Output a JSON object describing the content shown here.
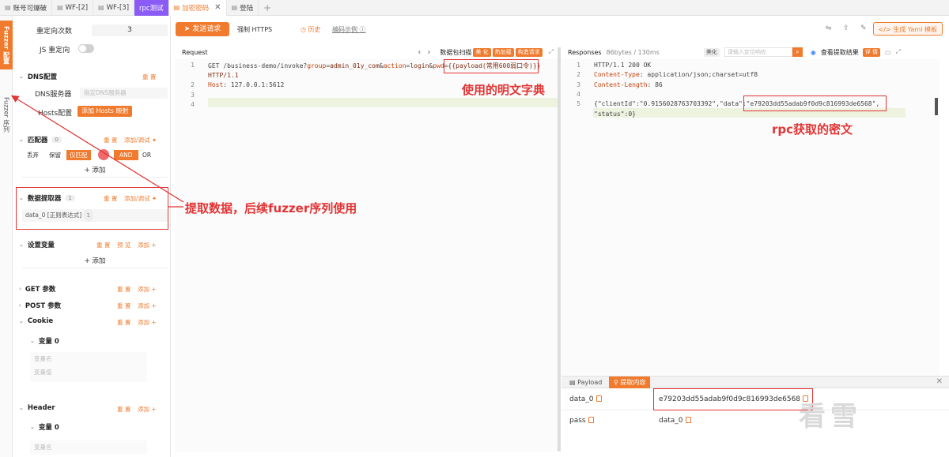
{
  "tabs": [
    {
      "label": "账号可爆破",
      "type": "normal"
    },
    {
      "label": "WF-[2]",
      "type": "normal"
    },
    {
      "label": "WF-[3]",
      "type": "normal"
    },
    {
      "label": "rpc测试",
      "type": "purple"
    },
    {
      "label": "加密密码",
      "type": "active"
    },
    {
      "label": "登陆",
      "type": "normal"
    }
  ],
  "sidetabs": {
    "fuzzer_config": "Fuzzer 配置",
    "fuzzer_sequence": "Fuzzer 序列"
  },
  "left": {
    "redirect_label": "重定向次数",
    "redirect_value": "3",
    "js_redirect_label": "JS 重定向",
    "dns_section": "DNS配置",
    "dns_reset": "重 置",
    "dns_server_label": "DNS服务器",
    "dns_server_placeholder": "指定DNS服务器",
    "hosts_label": "Hosts配置",
    "hosts_button": "添加 Hosts 映射",
    "matcher_section": "匹配器",
    "matcher_count": "0",
    "matcher_reset": "重 置",
    "matcher_add": "添加/调试 ✦",
    "matcher_opts": [
      "丢弃",
      "保留",
      "仅匹配"
    ],
    "logic_and": "AND",
    "logic_or": "OR",
    "add_label": "添加",
    "extractor_section": "数据提取器",
    "extractor_count": "1",
    "extractor_reset": "重 置",
    "extractor_add": "添加/调试 ✦",
    "extractor_item": "data_0 [正则表达式]",
    "extractor_item_count": "1",
    "vars_section": "设置变量",
    "vars_reset": "重 置",
    "vars_preview": "预 览",
    "vars_add": "添加 +",
    "get_section": "GET 参数",
    "post_section": "POST 参数",
    "cookie_section": "Cookie",
    "header_section": "Header",
    "reset": "重 置",
    "add": "添加 +",
    "var0": "变量 0",
    "var_name_placeholder": "变量名",
    "var_value_placeholder": "变量值"
  },
  "toolbar": {
    "send": "发送请求",
    "force_https": "强制 HTTPS",
    "history": "历史",
    "example": "编码示例",
    "yaml": "生成 Yaml 模板"
  },
  "request": {
    "title": "Request",
    "scan_label": "数据包扫描",
    "chips": [
      "美 化",
      "热加载",
      "构造请求"
    ],
    "lines": [
      {
        "n": "1",
        "parts": [
          [
            "t",
            "GET /business-demo/invoke?"
          ],
          [
            "k",
            "group"
          ],
          [
            "t",
            "="
          ],
          [
            "v",
            "admin_01y_com"
          ],
          [
            "t",
            "&"
          ],
          [
            "k",
            "action"
          ],
          [
            "t",
            "="
          ],
          [
            "v",
            "login"
          ],
          [
            "t",
            "&"
          ],
          [
            "k",
            "pwd"
          ],
          [
            "t",
            "="
          ],
          [
            "v",
            "{{payload(常用600弱口令)}}"
          ]
        ]
      },
      {
        "n": "",
        "parts": [
          [
            "v",
            "HTTP/1.1"
          ]
        ]
      },
      {
        "n": "2",
        "parts": [
          [
            "k",
            "Host"
          ],
          [
            "t",
            ": 127.0.0.1:5612"
          ]
        ]
      },
      {
        "n": "3",
        "parts": []
      },
      {
        "n": "4",
        "parts": []
      }
    ]
  },
  "response": {
    "title": "Responses",
    "meta": "86bytes / 130ms",
    "beautify": "美化",
    "search_placeholder": "请输入定位响应",
    "extract_result": "查看提取结果",
    "detail": "详 情",
    "lines": [
      {
        "n": "1",
        "parts": [
          [
            "t",
            "HTTP/1.1 200 OK"
          ]
        ]
      },
      {
        "n": "2",
        "parts": [
          [
            "k",
            "Content-Type"
          ],
          [
            "t",
            ": application/json;charset=utf8"
          ]
        ]
      },
      {
        "n": "3",
        "parts": [
          [
            "k",
            "Content-Length"
          ],
          [
            "t",
            ": 86"
          ]
        ]
      },
      {
        "n": "4",
        "parts": []
      },
      {
        "n": "5",
        "parts": [
          [
            "t",
            "{\"clientId\":\"0.9156028763703392\",\"data\":\"e79203dd55adab9f0d9c816993de6568\","
          ]
        ]
      },
      {
        "n": "",
        "parts": [
          [
            "t",
            "\"status\":0}"
          ]
        ]
      }
    ]
  },
  "bottom": {
    "tab_payload": "Payload",
    "tab_extract": "提取内容",
    "rows": [
      {
        "key": "data_0",
        "value": "e79203dd55adab9f0d9c816993de6568"
      },
      {
        "key": "pass",
        "value": "data_0"
      }
    ]
  },
  "annotations": {
    "plain_dict": "使用的明文字典",
    "rpc_cipher": "rpc获取的密文",
    "extract_note": "提取数据，后续fuzzer序列使用"
  },
  "watermark": "看雪",
  "colors": {
    "accent": "#f07b2e",
    "annotation": "#e23434",
    "purple_tab": "#8a5cf5"
  }
}
